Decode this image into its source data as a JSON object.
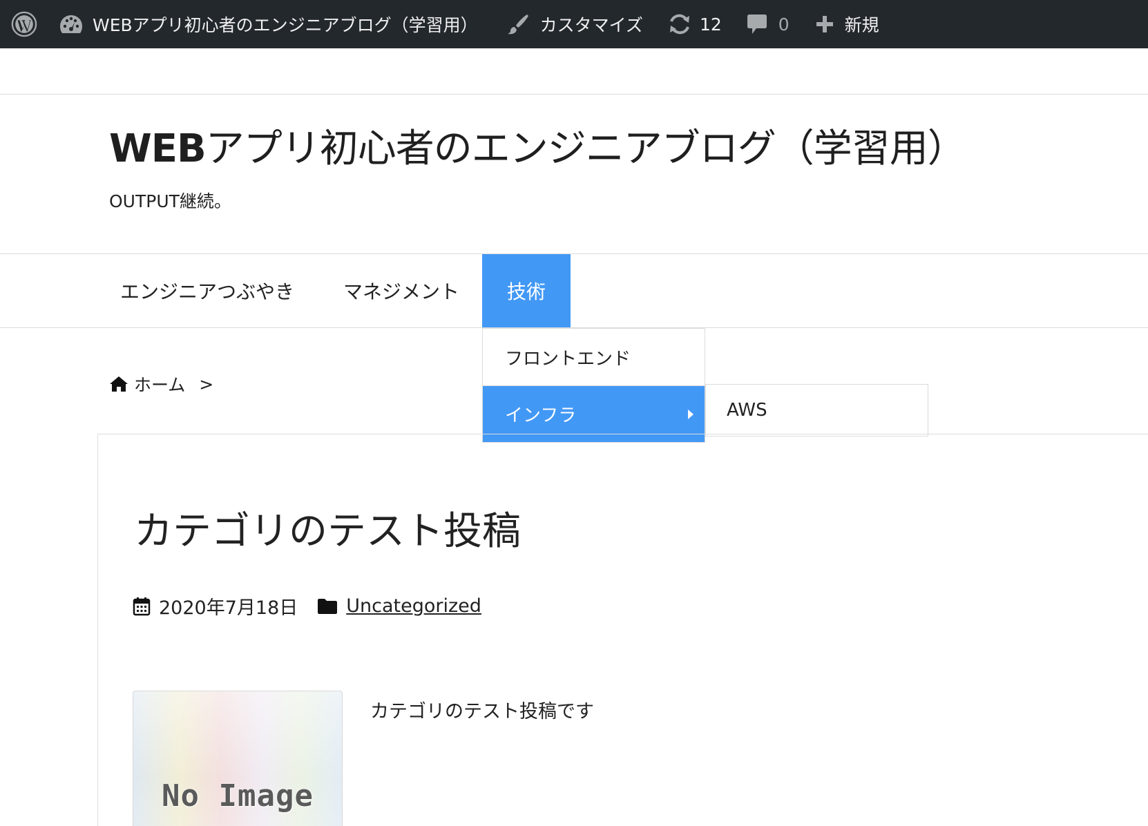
{
  "adminbar": {
    "site_name": "WEBアプリ初心者のエンジニアブログ（学習用）",
    "customize_label": "カスタマイズ",
    "updates_count": "12",
    "comments_count": "0",
    "new_label": "新規",
    "icons": [
      "wordpress-logo-icon",
      "dashboard-icon",
      "brush-icon",
      "updates-icon",
      "comment-icon",
      "plus-icon"
    ]
  },
  "header": {
    "title_prefix": "WEB",
    "title_rest": "アプリ初心者のエンジニアブログ（学習用）",
    "description": "OUTPUT継続。"
  },
  "nav": {
    "items": [
      {
        "label": "エンジニアつぶやき"
      },
      {
        "label": "マネジメント"
      },
      {
        "label": "技術",
        "active": true
      }
    ],
    "dropdown": [
      {
        "label": "フロントエンド"
      },
      {
        "label": "インフラ",
        "active": true
      }
    ],
    "submenu": [
      {
        "label": "AWS"
      }
    ],
    "accent_color": "#4298f5"
  },
  "breadcrumb": {
    "home": "ホーム",
    "separator": ">"
  },
  "post": {
    "title": "カテゴリのテスト投稿",
    "date": "2020年7月18日",
    "category": "Uncategorized",
    "thumbnail_text": "No Image",
    "excerpt": "カテゴリのテスト投稿です"
  }
}
